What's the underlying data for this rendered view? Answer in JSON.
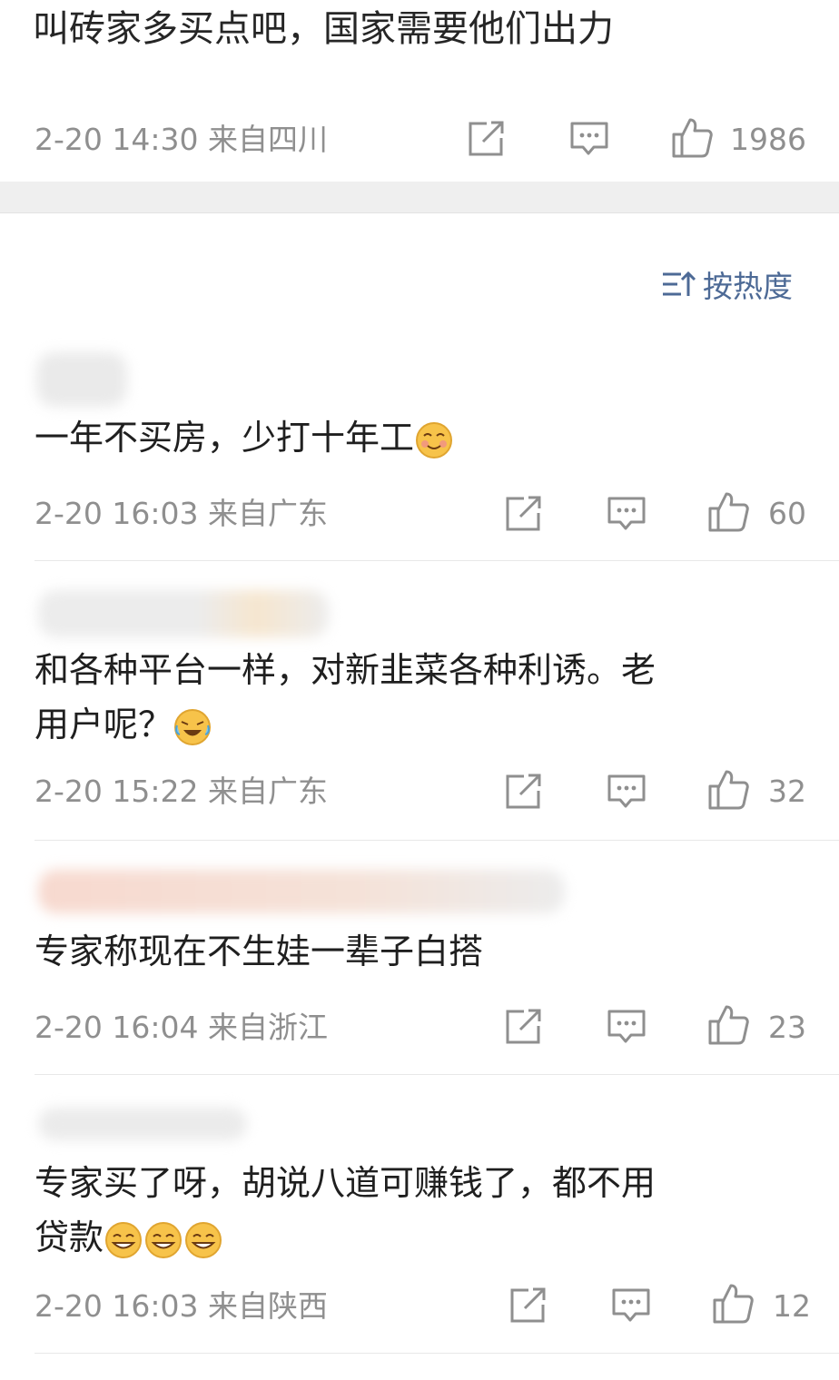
{
  "top_post": {
    "text": "叫砖家多买点吧，国家需要他们出力",
    "meta": "2-20 14:30 来自四川",
    "likes": "1986"
  },
  "sort_label": "按热度",
  "comments": [
    {
      "text": "一年不买房，少打十年工",
      "meta": "2-20 16:03 来自广东",
      "likes": "60",
      "emoji": "smile-emoji"
    },
    {
      "text_line1": "和各种平台一样，对新韭菜各种利诱。老",
      "text_line2": "用户呢？",
      "meta": "2-20 15:22 来自广东",
      "likes": "32",
      "emoji": "laugh-cry-emoji"
    },
    {
      "text": "专家称现在不生娃一辈子白搭",
      "meta": "2-20 16:04 来自浙江",
      "likes": "23"
    },
    {
      "text_line1": "专家买了呀，胡说八道可赚钱了，都不用",
      "text_line2": "贷款",
      "meta": "2-20 16:03 来自陕西",
      "likes": "12",
      "emoji": "grin-emoji"
    }
  ]
}
